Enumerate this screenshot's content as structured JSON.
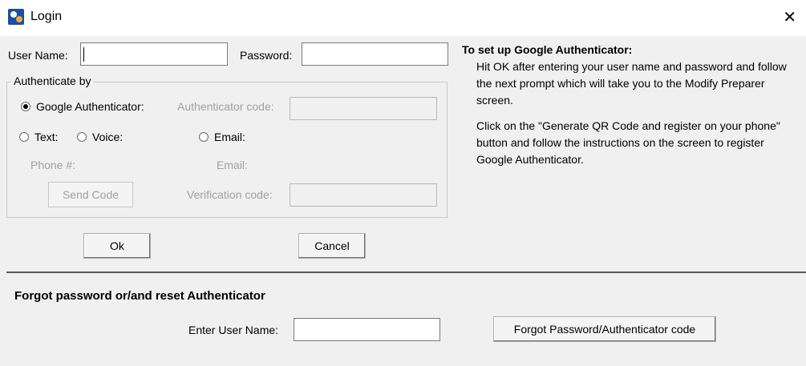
{
  "window": {
    "title": "Login",
    "close_glyph": "✕"
  },
  "login": {
    "username_label": "User Name:",
    "username_value": "",
    "password_label": "Password:",
    "password_value": ""
  },
  "auth": {
    "group_label": "Authenticate by",
    "google_label": "Google Authenticator:",
    "google_checked": true,
    "auth_code_label": "Authenticator code:",
    "text_label": "Text:",
    "voice_label": "Voice:",
    "email_radio_label": "Email:",
    "phone_label": "Phone #:",
    "email_label": "Email:",
    "send_code_label": "Send Code",
    "verification_label": "Verification code:"
  },
  "buttons": {
    "ok": "Ok",
    "cancel": "Cancel"
  },
  "info": {
    "title": "To set up Google Authenticator:",
    "para1": "Hit OK after entering your user name and password and follow the  next prompt which will take you to the Modify Preparer screen.",
    "para2": "Click on the \"Generate QR Code and register on your phone\" button and follow the instructions on the screen to register Google Authenticator."
  },
  "forgot": {
    "heading": "Forgot password or/and reset Authenticator",
    "enter_user_label": "Enter User Name:",
    "enter_user_value": "",
    "button_label": "Forgot Password/Authenticator code"
  },
  "icons": {
    "app": "app-logo-icon",
    "close": "close-icon"
  }
}
